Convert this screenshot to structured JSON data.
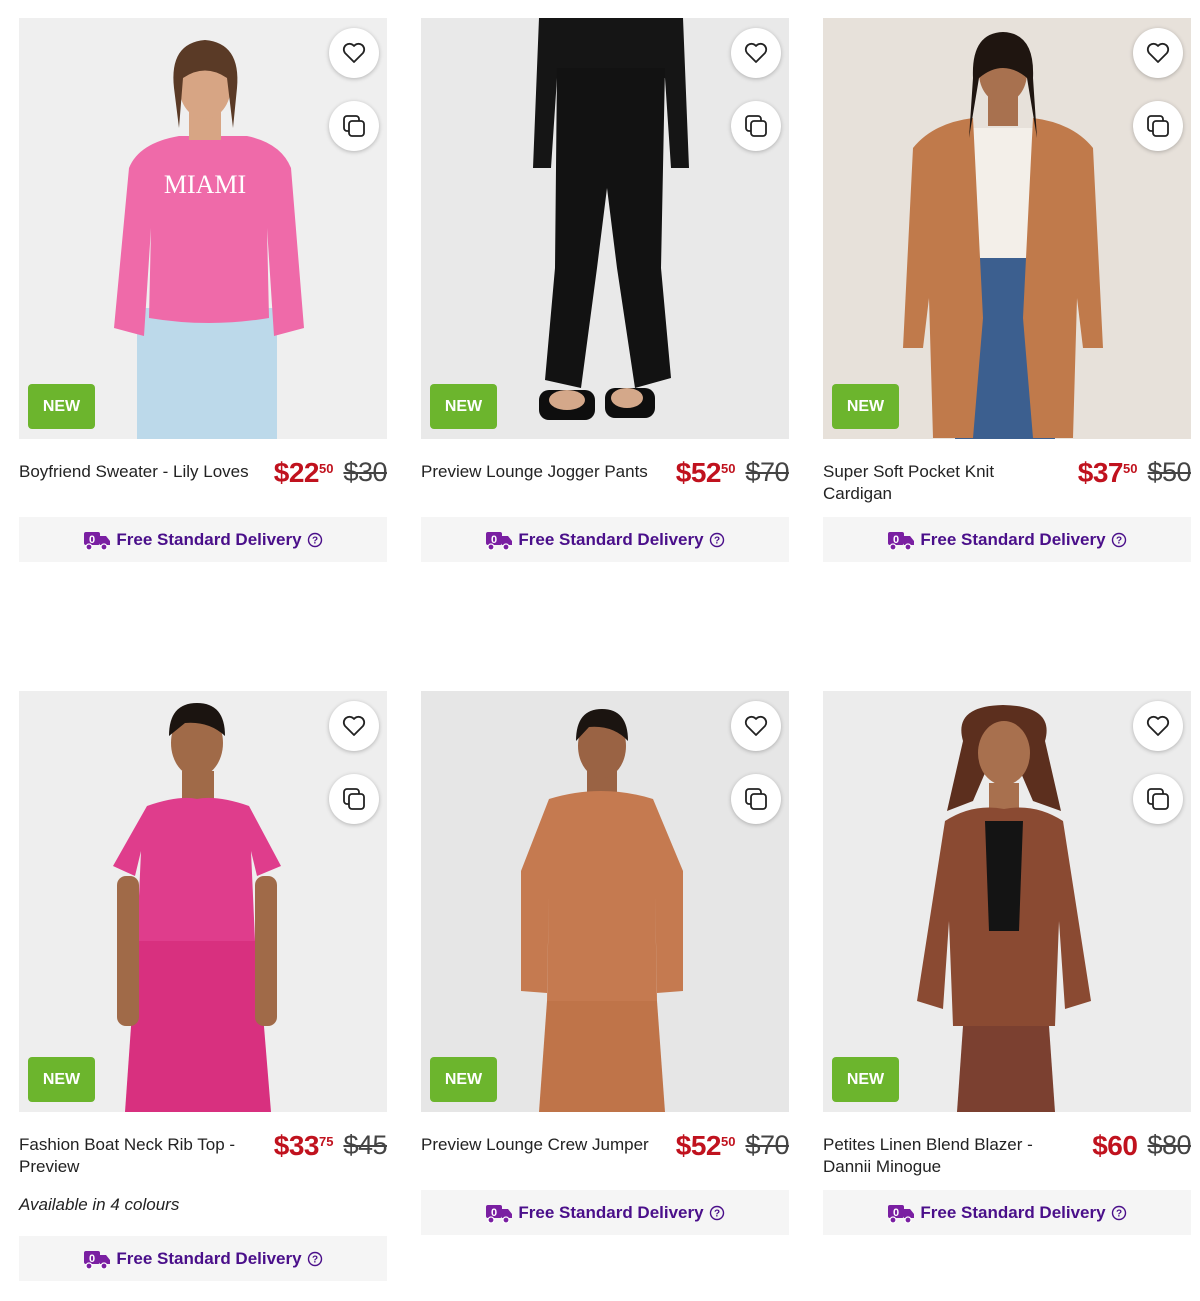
{
  "colors": {
    "price": "#c0121e",
    "badge": "#6cb52d",
    "delivery": "#4a0f8a"
  },
  "products": [
    {
      "name": "Boyfriend Sweater - Lily Loves",
      "badge": "NEW",
      "price": "$22",
      "cents": "50",
      "was": "$30",
      "availability": "",
      "delivery": "Free Standard Delivery"
    },
    {
      "name": "Preview Lounge Jogger Pants",
      "badge": "NEW",
      "price": "$52",
      "cents": "50",
      "was": "$70",
      "availability": "",
      "delivery": "Free Standard Delivery"
    },
    {
      "name": "Super Soft Pocket Knit Cardigan",
      "badge": "NEW",
      "price": "$37",
      "cents": "50",
      "was": "$50",
      "availability": "",
      "delivery": "Free Standard Delivery"
    },
    {
      "name": "Fashion Boat Neck Rib Top - Preview",
      "badge": "NEW",
      "price": "$33",
      "cents": "75",
      "was": "$45",
      "availability": "Available in 4 colours",
      "delivery": "Free Standard Delivery"
    },
    {
      "name": "Preview Lounge Crew Jumper",
      "badge": "NEW",
      "price": "$52",
      "cents": "50",
      "was": "$70",
      "availability": "",
      "delivery": "Free Standard Delivery"
    },
    {
      "name": "Petites Linen Blend Blazer - Dannii Minogue",
      "badge": "NEW",
      "price": "$60",
      "cents": "",
      "was": "$80",
      "availability": "",
      "delivery": "Free Standard Delivery"
    }
  ],
  "icons": {
    "wishlist": "heart-icon",
    "compare": "compare-icon",
    "delivery": "delivery-truck-icon",
    "help": "help-circle-icon"
  }
}
